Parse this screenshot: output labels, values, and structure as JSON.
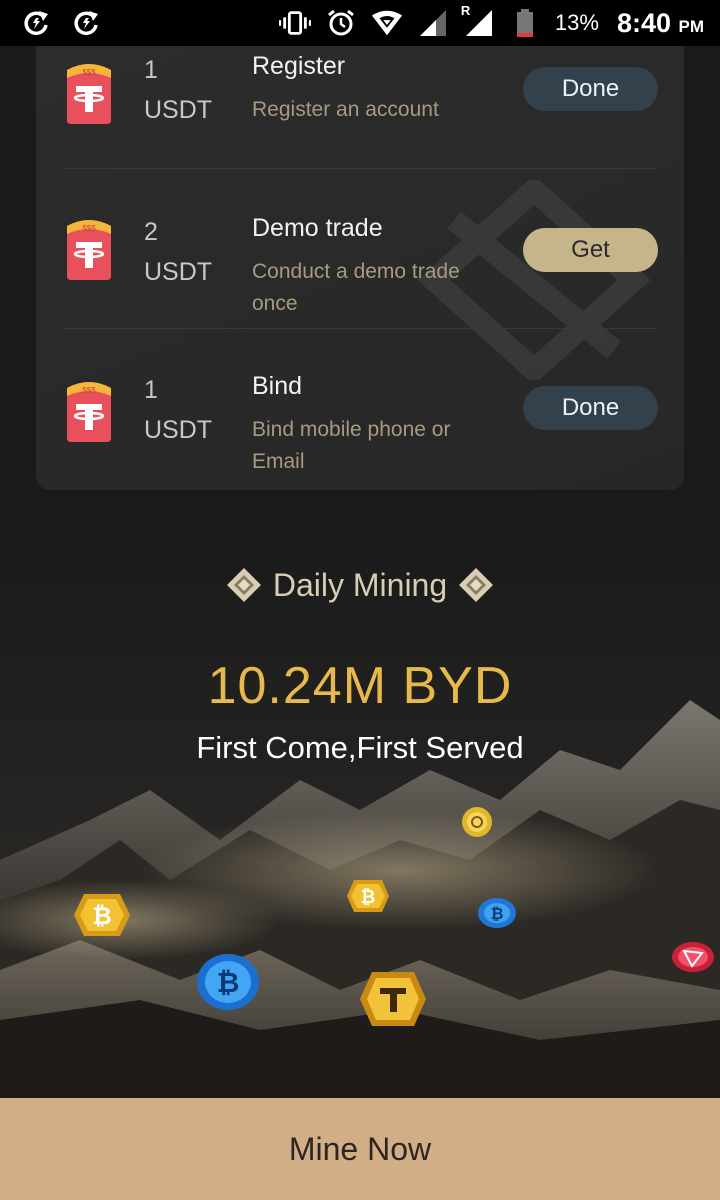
{
  "status_bar": {
    "battery_percent": "13%",
    "time": "8:40",
    "ampm": "PM",
    "roaming_indicator": "R",
    "icons": [
      "sync-icon",
      "sync-icon",
      "vibrate-icon",
      "alarm-icon",
      "wifi-icon",
      "signal-icon",
      "signal-roaming-icon",
      "battery-icon"
    ]
  },
  "tasks": [
    {
      "amount": "1",
      "unit": "USDT",
      "title": "Register",
      "description": "Register an account",
      "button": "Done",
      "state": "done"
    },
    {
      "amount": "2",
      "unit": "USDT",
      "title": "Demo trade",
      "description": "Conduct a demo trade once",
      "button": "Get",
      "state": "get"
    },
    {
      "amount": "1",
      "unit": "USDT",
      "title": "Bind",
      "description": "Bind mobile phone or Email",
      "button": "Done",
      "state": "done"
    }
  ],
  "mining": {
    "title": "Daily Mining",
    "amount": "10.24M BYD",
    "subtitle": "First Come,First Served"
  },
  "cta": {
    "label": "Mine Now"
  },
  "colors": {
    "background": "#1a1a1a",
    "card": "#2c2c2c",
    "done_button": "#33414c",
    "get_button": "#c6b48a",
    "gold_text": "#e6b94a",
    "cta": "#d2ae87"
  }
}
